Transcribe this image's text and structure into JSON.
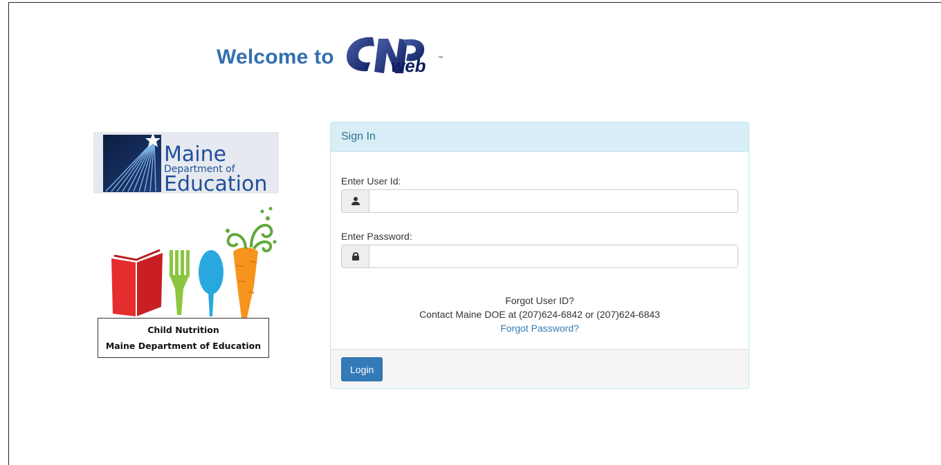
{
  "header": {
    "welcome_text": "Welcome to",
    "logo_text": "web"
  },
  "doe_logo": {
    "line1": "Maine",
    "line2": "Department of",
    "line3": "Education"
  },
  "cn_logo": {
    "caption_line1": "Child Nutrition",
    "caption_line2": "Maine Department of Education"
  },
  "signin": {
    "heading": "Sign In",
    "user_label": "Enter User Id:",
    "user_value": "",
    "password_label": "Enter Password:",
    "password_value": "",
    "forgot_user": "Forgot User ID?",
    "contact": "Contact Maine DOE at (207)624-6842 or (207)624-6843",
    "forgot_password": "Forgot Password?",
    "login_label": "Login"
  },
  "colors": {
    "brand_blue": "#336fb0",
    "panel_heading_bg": "#d9edf7",
    "button_blue": "#337ab7"
  },
  "icons": {
    "user": "user-icon",
    "lock": "lock-icon"
  }
}
